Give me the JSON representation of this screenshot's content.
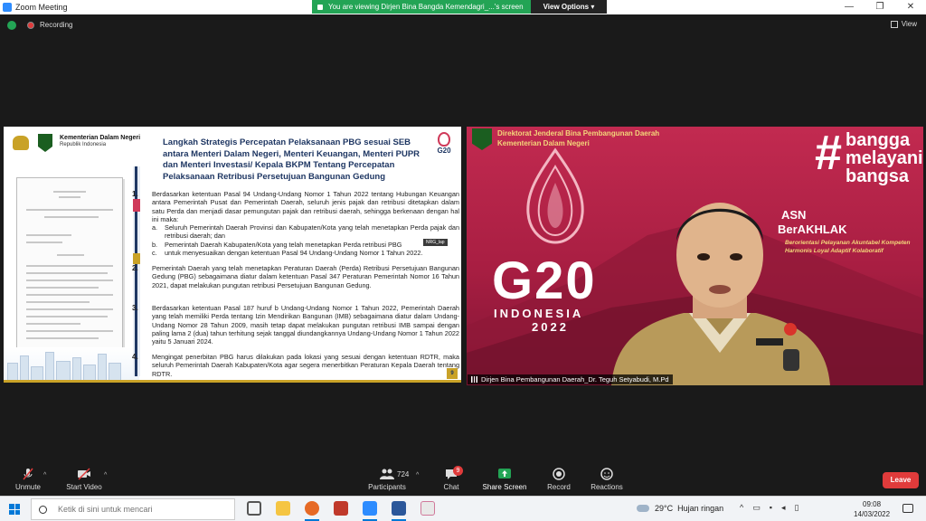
{
  "window": {
    "title": "Zoom Meeting",
    "banner_text": "You are viewing Dirjen Bina Bangda Kemendagri_...'s screen",
    "view_options": "View Options",
    "view_options_caret": "▾",
    "minimize": "—",
    "maximize": "❐",
    "close": "✕"
  },
  "topbar": {
    "recording": "Recording",
    "view": "View"
  },
  "slide": {
    "ministry": "Kementerian Dalam Negeri",
    "country": "Republik Indonesia",
    "title": "Langkah Strategis Percepatan Pelaksanaan PBG sesuai SEB antara Menteri Dalam Negeri, Menteri Keuangan, Menteri PUPR dan Menteri Investasi/ Kepala BKPM Tentang Percepatan Pelaksanaan Retribusi Persetujuan Bangunan Gedung",
    "g20_label": "G20",
    "tag": "NRG_lap",
    "page": "9",
    "items": [
      {
        "num": "1.",
        "text": "Berdasarkan ketentuan Pasal 94 Undang-Undang Nomor 1 Tahun 2022 tentang Hubungan Keuangan antara Pemerintah Pusat dan Pemerintah Daerah, seluruh jenis pajak dan retribusi ditetapkan dalam satu Perda dan menjadi dasar pemungutan pajak dan retribusi daerah, sehingga berkenaan dengan hal ini maka:",
        "subs": [
          {
            "l": "a.",
            "t": "Seluruh Pemerintah Daerah Provinsi dan Kabupaten/Kota yang telah menetapkan Perda pajak dan retribusi daerah; dan"
          },
          {
            "l": "b.",
            "t": "Pemerintah Daerah Kabupaten/Kota yang telah menetapkan Perda retribusi PBG"
          },
          {
            "l": "c.",
            "t": "untuk menyesuaikan dengan ketentuan Pasal 94 Undang-Undang Nomor 1 Tahun 2022."
          }
        ]
      },
      {
        "num": "2.",
        "text": "Pemerintah Daerah yang telah menetapkan Peraturan Daerah (Perda) Retribusi Persetujuan Bangunan Gedung (PBG) sebagaimana diatur dalam ketentuan Pasal 347 Peraturan Pemerintah Nomor 16 Tahun 2021, dapat melakukan pungutan retribusi Persetujuan Bangunan Gedung."
      },
      {
        "num": "3.",
        "text": "Berdasarkan ketentuan Pasal 187 huruf b Undang-Undang Nomor 1 Tahun 2022, Pemerintah Daerah yang telah memiliki Perda tentang Izin Mendirikan Bangunan (IMB) sebagaimana diatur dalam Undang-Undang Nomor 28 Tahun 2009, masih tetap dapat melakukan pungutan retribusi IMB sampai dengan paling lama 2 (dua) tahun terhitung sejak tanggal diundangkannya Undang-Undang Nomor 1 Tahun 2022 yaitu  5 Januari 2024."
      },
      {
        "num": "4.",
        "text": "Mengingat penerbitan PBG harus dilakukan pada lokasi yang sesuai dengan ketentuan RDTR, maka seluruh Pemerintah Daerah Kabupaten/Kota agar segera menerbitkan Peraturan Kepala Daerah tentang RDTR."
      }
    ]
  },
  "video": {
    "org_line1": "Direktorat Jenderal Bina Pembangunan Daerah",
    "org_line2": "Kementerian Dalam Negeri",
    "hash": "#",
    "bangga1": "bangga",
    "bangga2": "melayani",
    "bangga3": "bangsa",
    "asn1": "ASN",
    "asn2": "BerAKHLAK",
    "tagline1": "Berorientasi Pelayanan Akuntabel Kompeten",
    "tagline2": "Harmonis Loyal Adaptif Kolaboratif",
    "g20": "G20",
    "indonesia": "INDONESIA",
    "year": "2022",
    "caption": "Dirjen Bina Pembangunan Daerah_Dr. Teguh Setyabudi, M.Pd"
  },
  "controls": {
    "unmute": "Unmute",
    "start_video": "Start Video",
    "participants": "Participants",
    "participants_count": "724",
    "chat": "Chat",
    "chat_badge": "9",
    "share_screen": "Share Screen",
    "record": "Record",
    "reactions": "Reactions",
    "leave": "Leave",
    "caret": "^"
  },
  "taskbar": {
    "search_placeholder": "Ketik di sini untuk mencari",
    "temperature": "29°C",
    "weather": "Hujan ringan",
    "time": "09:08",
    "date": "14/03/2022"
  },
  "colors": {
    "zoom_green": "#23a455",
    "leave_red": "#e03b3b",
    "slide_title": "#1f3763",
    "video_bg": "#c22a50",
    "gold": "#f4d77a"
  }
}
